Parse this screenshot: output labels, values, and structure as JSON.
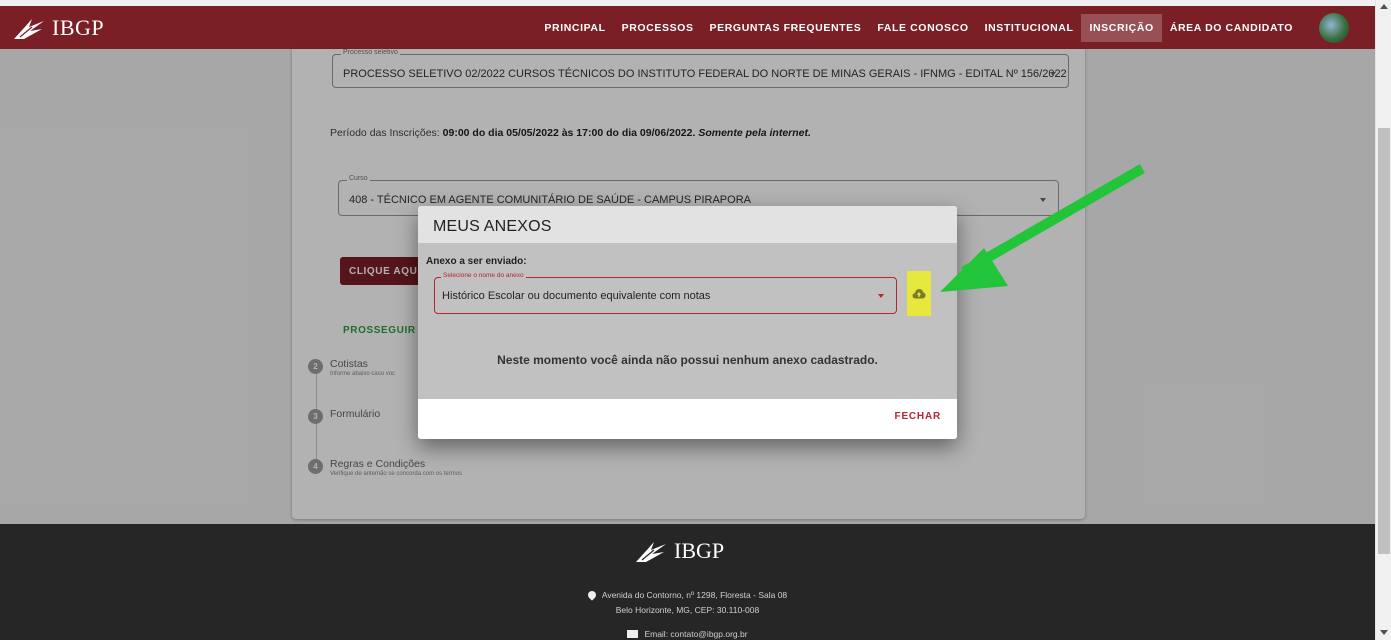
{
  "header": {
    "brand": "IBGP",
    "nav": [
      {
        "label": "PRINCIPAL"
      },
      {
        "label": "PROCESSOS"
      },
      {
        "label": "PERGUNTAS FREQUENTES"
      },
      {
        "label": "FALE CONOSCO"
      },
      {
        "label": "INSTITUCIONAL"
      },
      {
        "label": "INSCRIÇÃO",
        "active": true
      },
      {
        "label": "ÁREA DO CANDIDATO"
      }
    ]
  },
  "form": {
    "processo": {
      "legend": "Processo seletivo",
      "value": "PROCESSO SELETIVO 02/2022 CURSOS TÉCNICOS DO INSTITUTO FEDERAL DO NORTE DE MINAS GERAIS - IFNMG - EDITAL Nº 156/2022"
    },
    "periodo": {
      "prefix": "Período das Inscrições: ",
      "range": "09:00 do dia 05/05/2022 às 17:00 do dia 09/06/2022.",
      "note": "Somente pela internet."
    },
    "curso": {
      "legend": "Curso",
      "value": "408 - TÉCNICO EM AGENTE COMUNITÁRIO DE SAÚDE - CAMPUS PIRAPORA"
    },
    "clique_label": "CLIQUE AQUI",
    "prosseguir_label": "PROSSEGUIR"
  },
  "steps": [
    {
      "num": "2",
      "title": "Cotistas",
      "sub": "Informe abaixo caso voc"
    },
    {
      "num": "3",
      "title": "Formulário",
      "sub": ""
    },
    {
      "num": "4",
      "title": "Regras e Condições",
      "sub": "Verifique de antemão se concorda com os termos"
    }
  ],
  "modal": {
    "title": "MEUS ANEXOS",
    "anexo_label": "Anexo a ser enviado:",
    "select_legend": "Selecione o nome do anexo",
    "select_value": "Histórico Escolar ou documento equivalente com notas",
    "empty_message": "Neste momento você ainda não possui nenhum anexo cadastrado.",
    "close_label": "FECHAR",
    "upload_icon": "cloud-upload-icon"
  },
  "footer": {
    "brand": "IBGP",
    "address_line1": "Avenida do Contorno, nº 1298, Floresta - Sala 08",
    "address_line2": "Belo Horizonte, MG, CEP: 30.110-008",
    "email": "Email: contato@ibgp.org.br"
  },
  "colors": {
    "brand": "#7a1f26",
    "accent_red": "#b3272f",
    "success_green": "#2e9e3c",
    "highlight_yellow": "#e7e83e",
    "arrow_green": "#22c43a"
  }
}
